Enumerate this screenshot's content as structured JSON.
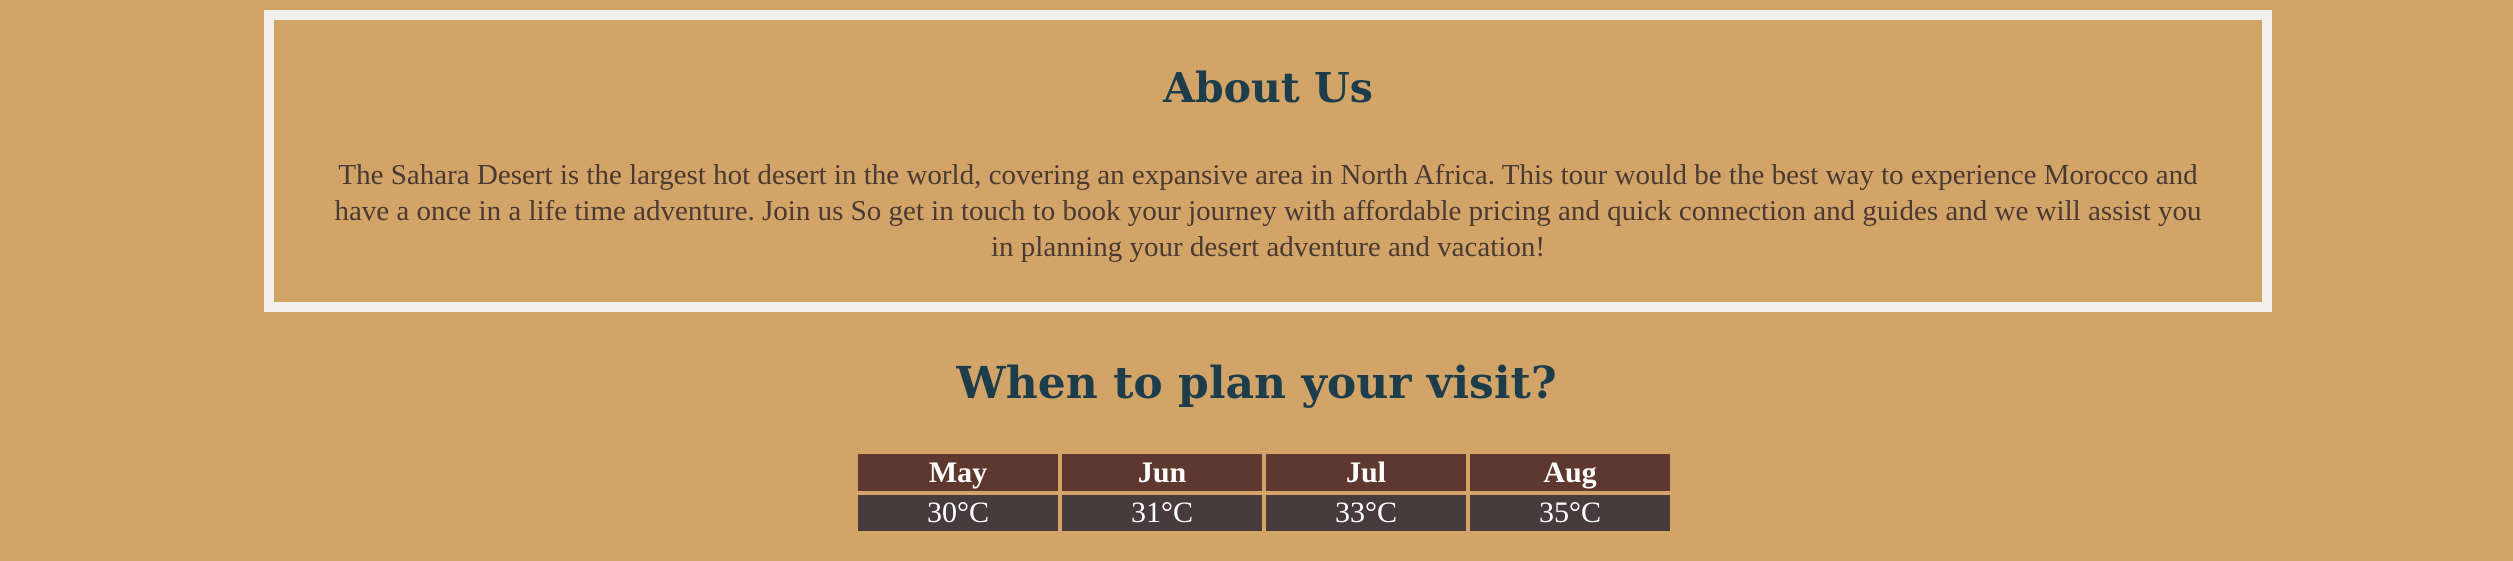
{
  "about": {
    "title": "About Us",
    "text": "The Sahara Desert is the largest hot desert in the world, covering an expansive area in North Africa. This tour would be the best way to experience Morocco and have a once in a life time adventure. Join us So get in touch to book your journey with affordable pricing and quick connection and guides and we will assist you in planning your desert adventure and vacation!"
  },
  "visit": {
    "title": "When to plan your visit?",
    "months": [
      "May",
      "Jun",
      "Jul",
      "Aug"
    ],
    "temperatures": [
      "30°C",
      "31°C",
      "33°C",
      "35°C"
    ]
  },
  "colors": {
    "background": "#D2A467",
    "heading": "#1E3D4B",
    "border": "#F2F0EC",
    "header_cell": "#5E382E",
    "value_cell": "#483B3D"
  }
}
